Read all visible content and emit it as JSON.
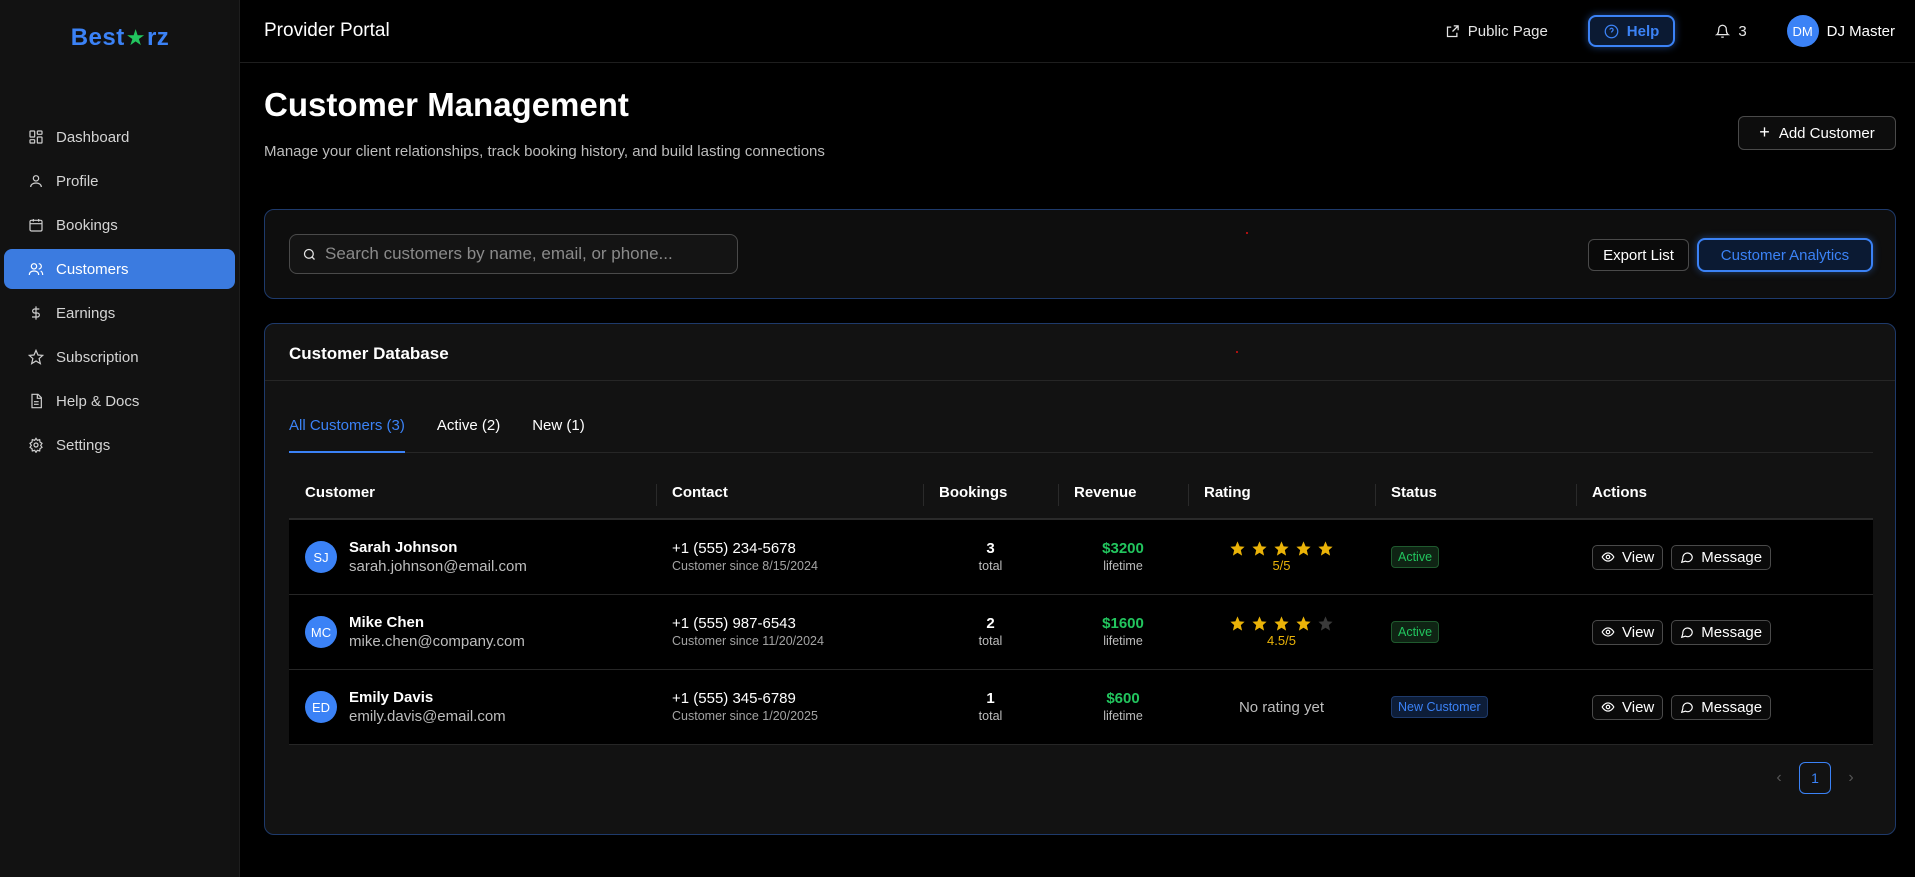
{
  "brand": {
    "name_left": "Best",
    "name_right": "rz",
    "star": "★",
    "color": "#3b82f6",
    "star_color": "#22c55e"
  },
  "sidebar": {
    "items": [
      {
        "label": "Dashboard",
        "icon": "dashboard-icon"
      },
      {
        "label": "Profile",
        "icon": "user-icon"
      },
      {
        "label": "Bookings",
        "icon": "calendar-icon"
      },
      {
        "label": "Customers",
        "icon": "users-icon",
        "active": true
      },
      {
        "label": "Earnings",
        "icon": "dollar-icon"
      },
      {
        "label": "Subscription",
        "icon": "star-icon"
      },
      {
        "label": "Help & Docs",
        "icon": "document-icon"
      },
      {
        "label": "Settings",
        "icon": "gear-icon"
      }
    ]
  },
  "topbar": {
    "title": "Provider Portal",
    "public_page": "Public Page",
    "help": "Help",
    "notifications_count": "3",
    "user_initials": "DM",
    "user_name": "DJ Master"
  },
  "header": {
    "title": "Customer Management",
    "subtitle": "Manage your client relationships, track booking history, and build lasting connections",
    "add_button": "Add Customer"
  },
  "search": {
    "placeholder": "Search customers by name, email, or phone...",
    "export_label": "Export List",
    "analytics_label": "Customer Analytics"
  },
  "database": {
    "title": "Customer Database",
    "tabs": [
      "All Customers (3)",
      "Active (2)",
      "New (1)"
    ],
    "columns": [
      "Customer",
      "Contact",
      "Bookings",
      "Revenue",
      "Rating",
      "Status",
      "Actions"
    ],
    "rows": [
      {
        "initials": "SJ",
        "name": "Sarah Johnson",
        "email": "sarah.johnson@email.com",
        "phone": "+1 (555) 234-5678",
        "since": "Customer since 8/15/2024",
        "bookings": "3",
        "bookings_unit": "total",
        "revenue": "$3200",
        "revenue_unit": "lifetime",
        "stars": 5,
        "rating": "5/5",
        "status": "Active",
        "status_kind": "active"
      },
      {
        "initials": "MC",
        "name": "Mike Chen",
        "email": "mike.chen@company.com",
        "phone": "+1 (555) 987-6543",
        "since": "Customer since 11/20/2024",
        "bookings": "2",
        "bookings_unit": "total",
        "revenue": "$1600",
        "revenue_unit": "lifetime",
        "stars": 4,
        "rating": "4.5/5",
        "status": "Active",
        "status_kind": "active"
      },
      {
        "initials": "ED",
        "name": "Emily Davis",
        "email": "emily.davis@email.com",
        "phone": "+1 (555) 345-6789",
        "since": "Customer since 1/20/2025",
        "bookings": "1",
        "bookings_unit": "total",
        "revenue": "$600",
        "revenue_unit": "lifetime",
        "stars": 0,
        "rating": "No rating yet",
        "status": "New Customer",
        "status_kind": "new"
      }
    ],
    "view_label": "View",
    "message_label": "Message",
    "page": "1",
    "prev": "‹",
    "next": "›"
  },
  "colors": {
    "accent": "#3b82f6",
    "success": "#22c55e",
    "star": "#eab308",
    "star_empty": "#3a3a3a"
  }
}
